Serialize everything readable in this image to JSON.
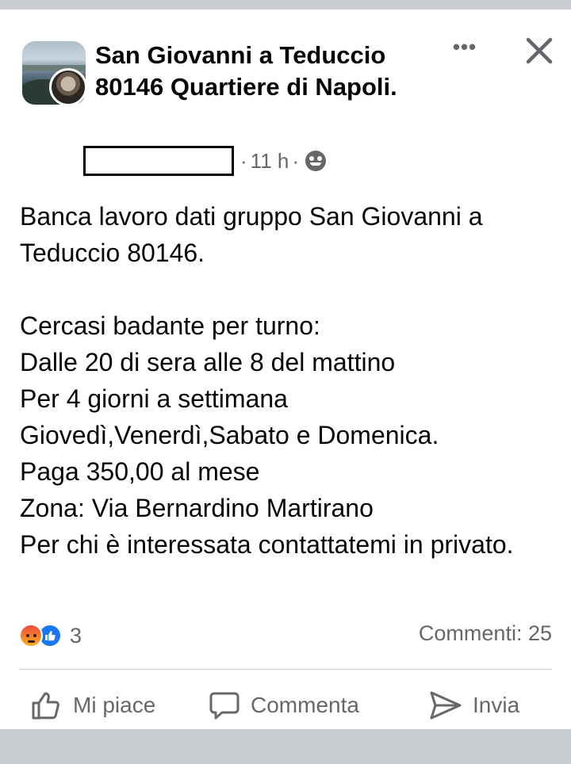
{
  "post": {
    "group_name": "San Giovanni a Teduccio 80146 Quartiere di Napoli.",
    "time_ago": "11 h",
    "meta_separator": "·",
    "body": "Banca lavoro dati gruppo San Giovanni a Teduccio 80146.\n\nCercasi badante per turno:\nDalle 20 di sera alle 8 del mattino\nPer 4 giorni a settimana\nGiovedì,Venerdì,Sabato e Domenica.\nPaga 350,00 al mese\nZona: Via Bernardino Martirano\nPer chi è interessata contattatemi in privato.",
    "more_label": "•••",
    "privacy_icon": "group-icon"
  },
  "reactions": {
    "types": [
      "angry",
      "like"
    ],
    "count": "3"
  },
  "comments_count": "Commenti: 25",
  "actions": {
    "like": "Mi piace",
    "comment": "Commenta",
    "send": "Invia"
  },
  "colors": {
    "accent": "#1877f2",
    "secondary_text": "#65676b",
    "background": "#c9ccd1"
  }
}
